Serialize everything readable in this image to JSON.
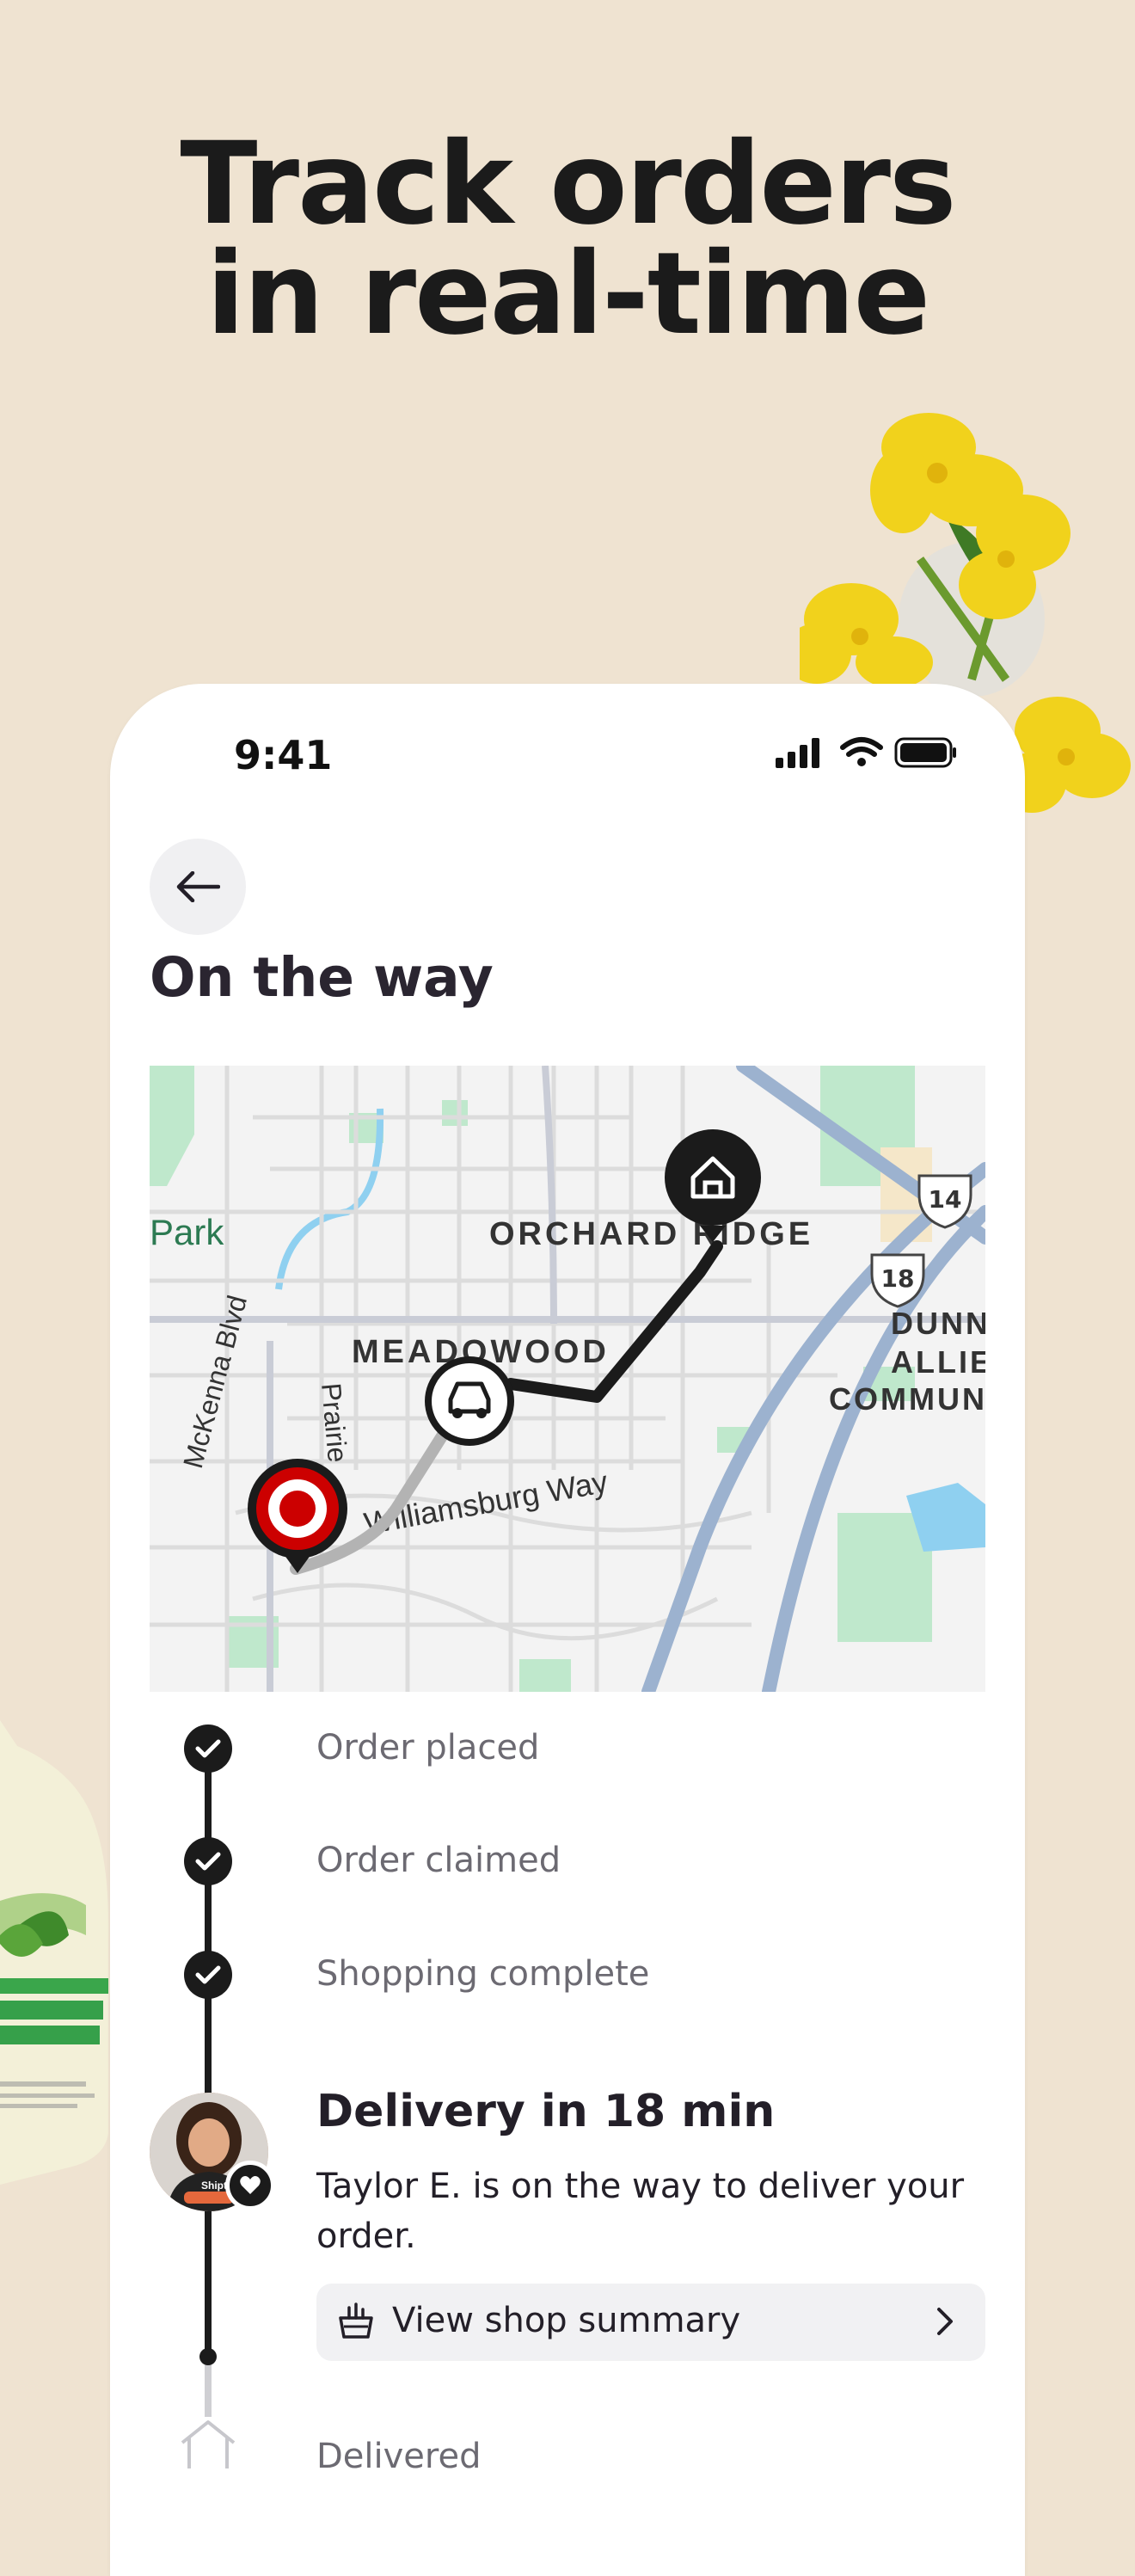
{
  "headline": {
    "line1": "Track orders",
    "line2": "in real-time"
  },
  "status_bar": {
    "time": "9:41"
  },
  "page": {
    "title": "On the way"
  },
  "map": {
    "labels": {
      "park": "Park",
      "orchard_ridge": "ORCHARD RIDGE",
      "meadowood": "MEADOWOOD",
      "mckenna": "McKenna Blvd",
      "prairie": "Prairie",
      "williamsburg": "Williamsburg Way",
      "dunn1": "DUNN",
      "dunn2": "ALLIE",
      "dunn3": "COMMUN",
      "hwy14": "14",
      "hwy18": "18"
    },
    "colors": {
      "route": "#1b1b1b",
      "route_done": "#b3b3b3",
      "store_pin": "#cc0000",
      "water": "#8fd0f0",
      "green": "#bfe8cc",
      "highway": "#9cb2cf"
    }
  },
  "timeline": {
    "steps": [
      {
        "label": "Order placed",
        "status": "done"
      },
      {
        "label": "Order claimed",
        "status": "done"
      },
      {
        "label": "Shopping complete",
        "status": "done"
      },
      {
        "label": "Delivered",
        "status": "pending"
      }
    ],
    "current": {
      "title": "Delivery in 18 min",
      "text": "Taylor E. is on the way to deliver your order.",
      "button_label": "View shop summary"
    }
  }
}
